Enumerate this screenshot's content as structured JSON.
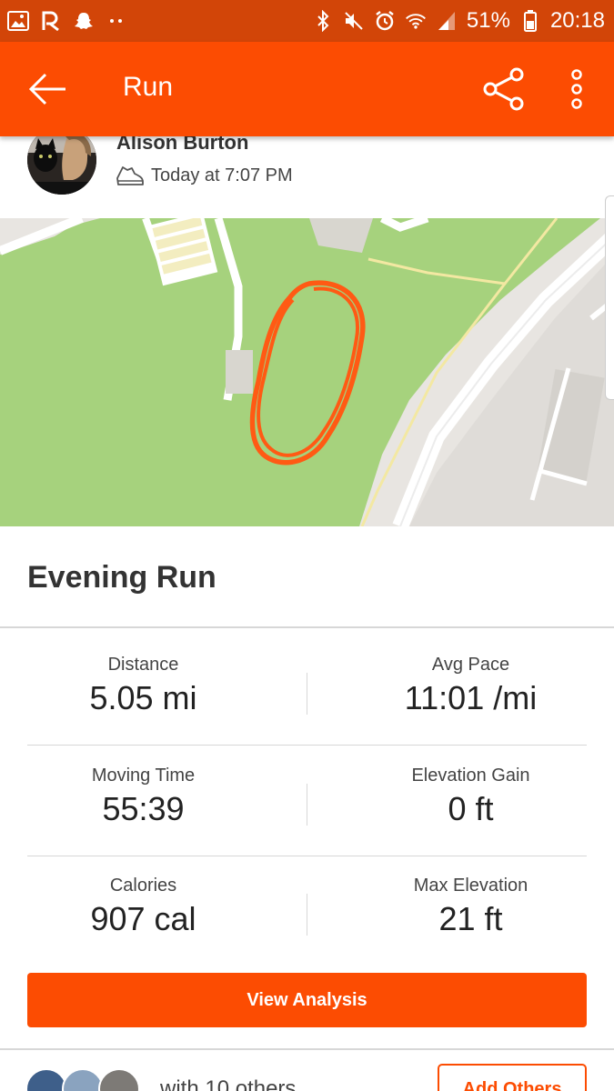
{
  "status_bar": {
    "battery_percent": "51%",
    "time": "20:18"
  },
  "app_bar": {
    "title": "Run"
  },
  "athlete": {
    "name": "Alison Burton",
    "activity_time": "Today at 7:07 PM"
  },
  "activity": {
    "title": "Evening Run"
  },
  "stats": [
    {
      "left_label": "Distance",
      "left_value": "5.05 mi",
      "right_label": "Avg Pace",
      "right_value": "11:01 /mi"
    },
    {
      "left_label": "Moving Time",
      "left_value": "55:39",
      "right_label": "Elevation Gain",
      "right_value": "0 ft"
    },
    {
      "left_label": "Calories",
      "left_value": "907 cal",
      "right_label": "Max Elevation",
      "right_value": "21 ft"
    }
  ],
  "actions": {
    "view_analysis": "View Analysis",
    "with_others": "with 10 others",
    "add_others": "Add Others"
  },
  "colors": {
    "brand": "#fc4c02",
    "status_bar": "#d24508",
    "map_park": "#a5d07b",
    "route": "#ff5a14"
  },
  "icons": [
    "image-icon",
    "strava-icon",
    "snapchat-icon",
    "more-notifications-icon",
    "bluetooth-icon",
    "mute-icon",
    "alarm-icon",
    "wifi-icon",
    "signal-icon",
    "battery-icon",
    "back-arrow-icon",
    "share-icon",
    "overflow-menu-icon",
    "shoe-icon"
  ]
}
